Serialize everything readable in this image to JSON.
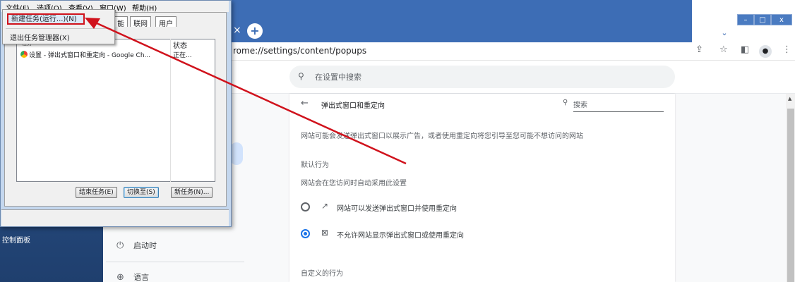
{
  "desktop": {
    "label": "控制面板"
  },
  "browser": {
    "url": "rome://settings/content/popups",
    "tab_close": "×",
    "new_tab": "+",
    "tab_search": "⌄",
    "window_buttons": {
      "minimize": "–",
      "maximize": "□",
      "close": "x"
    }
  },
  "toolbar_icons": {
    "share": "⇪",
    "bookmark": "☆",
    "sidebar": "◧",
    "profile": "●",
    "menu": "⋮"
  },
  "settings": {
    "search_placeholder": "在设置中搜索",
    "nav": [
      {
        "icon": "⏻",
        "label": "启动时"
      },
      {
        "icon": "⊕",
        "label": "语言"
      }
    ],
    "page": {
      "back": "←",
      "title": "弹出式窗口和重定向",
      "search_icon": "🔍",
      "search_label": "搜索",
      "description": "网站可能会发送弹出式窗口以展示广告，或者使用重定向将您引导至您可能不想访问的网站",
      "default_heading": "默认行为",
      "default_sub": "网站会在您访问时自动采用此设置",
      "options": [
        {
          "icon": "↗",
          "label": "网站可以发送弹出式窗口并使用重定向",
          "selected": false
        },
        {
          "icon": "⊠",
          "label": "不允许网站显示弹出式窗口或使用重定向",
          "selected": true
        }
      ],
      "custom_heading": "自定义的行为"
    }
  },
  "task_manager": {
    "menus": [
      "文件(F)",
      "选项(O)",
      "查看(V)",
      "窗口(W)",
      "帮助(H)"
    ],
    "tabs": [
      "能",
      "联网",
      "用户"
    ],
    "columns": {
      "task": "任务",
      "status": "状态"
    },
    "rows": [
      {
        "name": "设置 - 弹出式窗口和重定向 - Google Ch...",
        "status": "正在..."
      }
    ],
    "buttons": {
      "end": "结束任务(E)",
      "switch": "切换至(S)",
      "new": "新任务(N)..."
    },
    "file_menu": {
      "new_task": "新建任务(运行...)(N)",
      "exit": "退出任务管理器(X)"
    }
  },
  "colors": {
    "annotation": "#d0121c",
    "chrome_frame": "#3d6db5",
    "accent": "#1a73e8"
  }
}
